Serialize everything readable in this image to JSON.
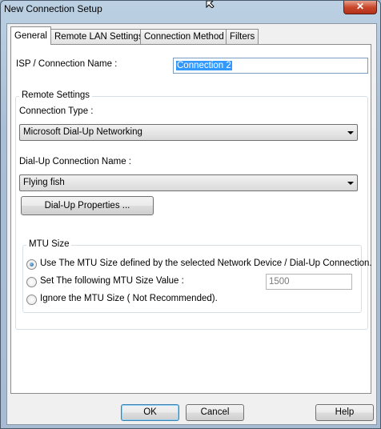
{
  "window": {
    "title": "New Connection Setup",
    "close_label": "✕"
  },
  "tabs": [
    {
      "label": "General",
      "active": true
    },
    {
      "label": "Remote LAN Settings",
      "active": false
    },
    {
      "label": "Connection Method",
      "active": false
    },
    {
      "label": "Filters",
      "active": false
    }
  ],
  "general": {
    "isp_label": "ISP / Connection Name :",
    "isp_value": "Connection 2",
    "remote_settings": {
      "legend": "Remote Settings",
      "connection_type_label": "Connection Type :",
      "connection_type_value": "Microsoft Dial-Up Networking",
      "dialup_name_label": "Dial-Up Connection Name :",
      "dialup_name_value": "Flying fish",
      "dialup_properties_button": "Dial-Up Properties ..."
    },
    "mtu": {
      "legend": "MTU Size",
      "options": [
        {
          "label": "Use The MTU Size defined by the selected Network Device / Dial-Up Connection.",
          "checked": true
        },
        {
          "label": "Set The following MTU Size Value :",
          "checked": false
        },
        {
          "label": "Ignore the MTU Size ( Not Recommended).",
          "checked": false
        }
      ],
      "value": "1500"
    }
  },
  "footer": {
    "ok": "OK",
    "cancel": "Cancel",
    "help": "Help"
  }
}
